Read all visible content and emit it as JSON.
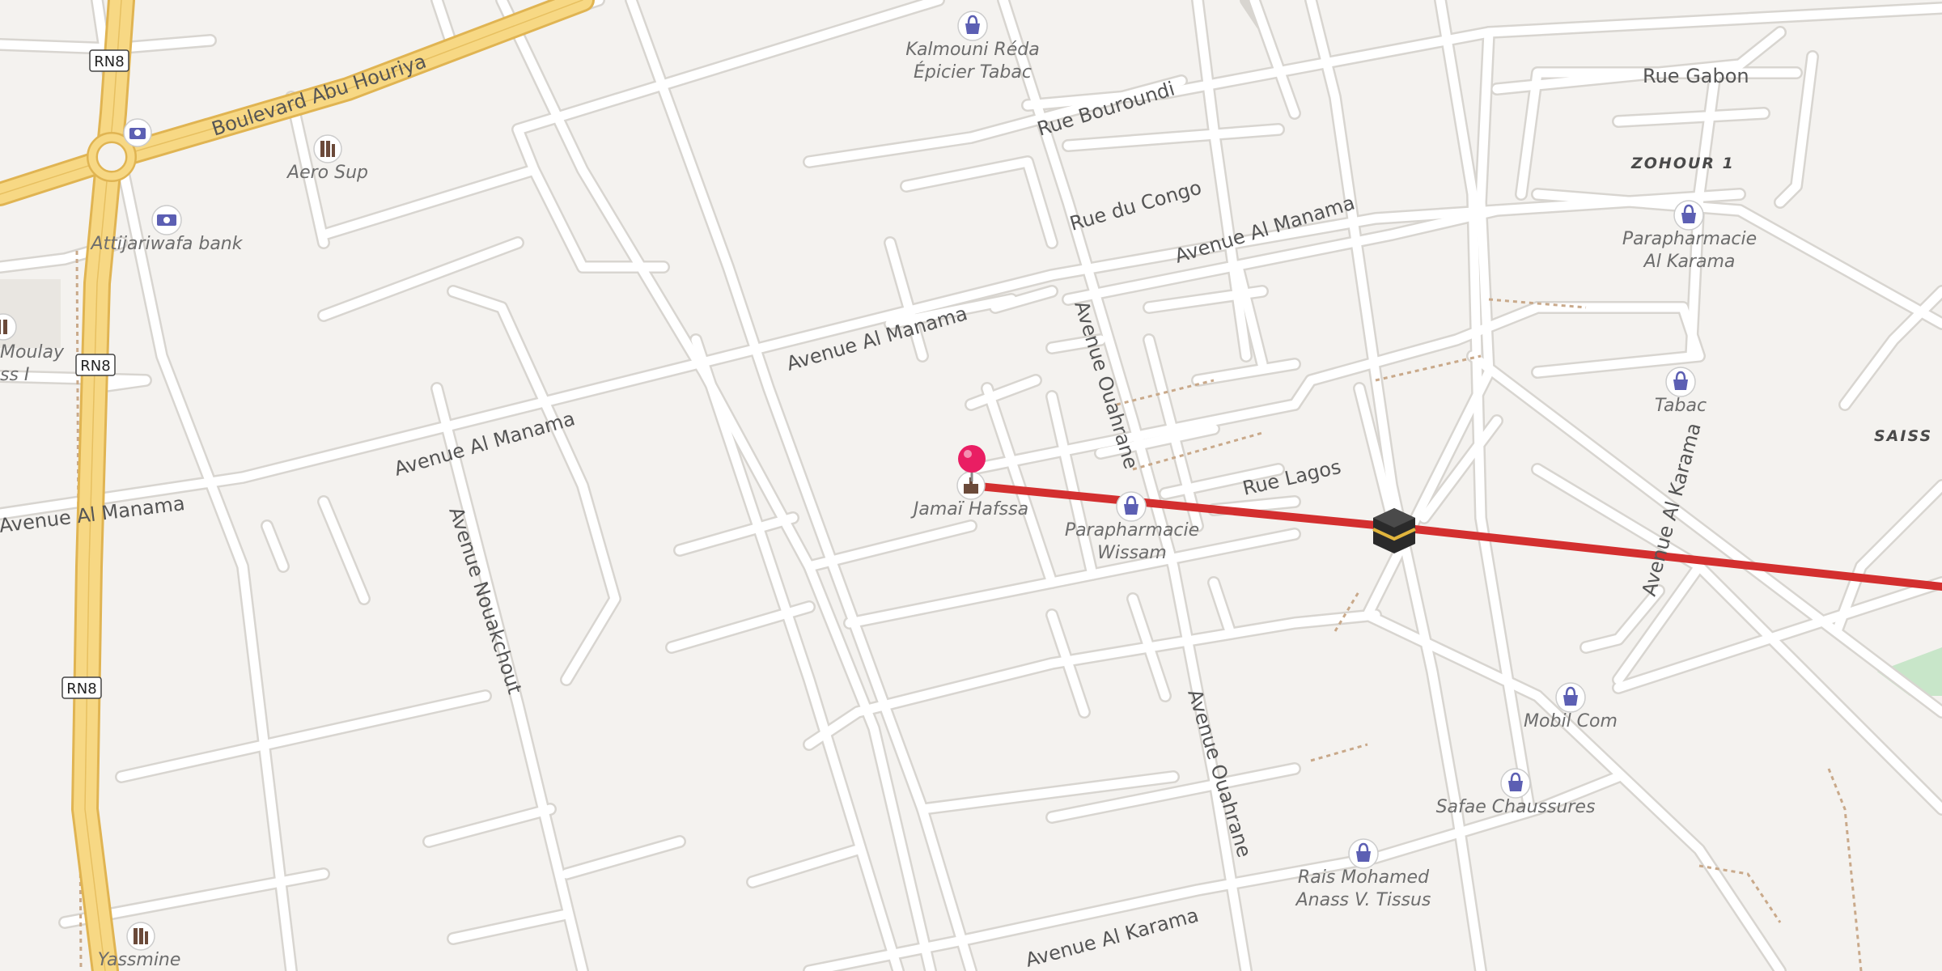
{
  "map": {
    "colors": {
      "background": "#f4f2ef",
      "road": "#ffffff",
      "road_casing": "#d5d2cd",
      "highway": "#f7d884",
      "highway_casing": "#e0b452",
      "route": "#d32f2f",
      "pin": "#e91e63",
      "poi_shop": "#5c5fb3"
    },
    "route_shields": [
      "RN8",
      "RN8",
      "RN8"
    ],
    "streets": {
      "boulevard_abu_houriya": "Boulevard Abu Houriya",
      "rue_bouroundi": "Rue Bouroundi",
      "rue_du_congo": "Rue du Congo",
      "avenue_al_manama_1": "Avenue Al Manama",
      "avenue_al_manama_2": "Avenue Al Manama",
      "avenue_al_manama_3": "Avenue Al Manama",
      "avenue_al_manama_4": "Avenue Al Manama",
      "avenue_ouahrane_1": "Avenue Ouahrane",
      "avenue_ouahrane_2": "Avenue Ouahrane",
      "avenue_nouakchout": "Avenue Nouakchout",
      "rue_lagos": "Rue Lagos",
      "rue_gabon": "Rue Gabon",
      "avenue_al_karama_1": "Avenue Al Karama",
      "avenue_al_karama_2": "Avenue Al Karama"
    },
    "districts": {
      "zohour1": "ZOHOUR 1",
      "saiss": "SAISS"
    },
    "pois": {
      "kalmouni_1": "Kalmouni Réda",
      "kalmouni_2": "Épicier Tabac",
      "aero_sup": "Aero Sup",
      "attijariwafa": "Attijariwafa bank",
      "moulay_1": "Moulay",
      "moulay_2": "ss I",
      "jamai_hafssa": "Jamaï Hafssa",
      "parapharmacie_wissam_1": "Parapharmacie",
      "parapharmacie_wissam_2": "Wissam",
      "parapharmacie_karama_1": "Parapharmacie",
      "parapharmacie_karama_2": "Al Karama",
      "tabac": "Tabac",
      "mobil_com": "Mobil Com",
      "safae": "Safae Chaussures",
      "rais_1": "Rais Mohamed",
      "rais_2": "Anass V. Tissus",
      "yassmine": "Yassmine"
    }
  }
}
